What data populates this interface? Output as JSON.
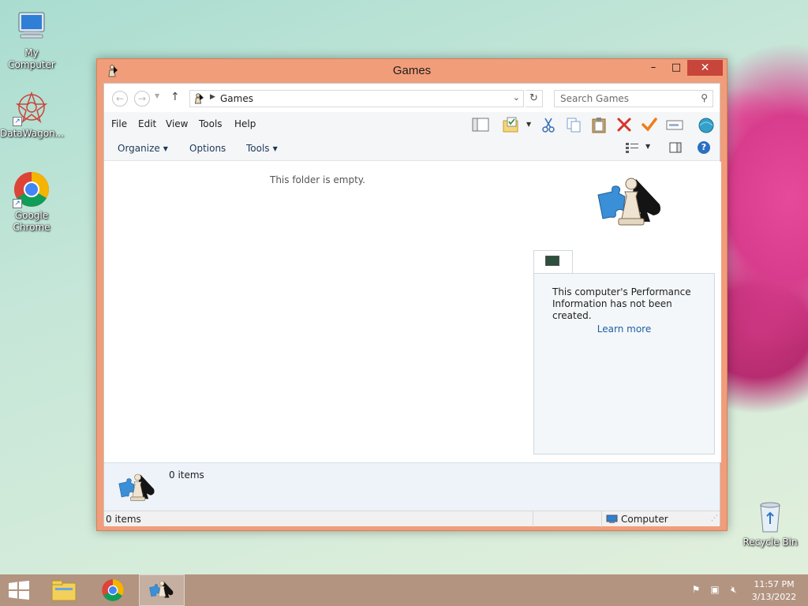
{
  "desktop": {
    "icons": [
      {
        "label": "My Computer"
      },
      {
        "label": "DataWagon..."
      },
      {
        "label": "Google Chrome"
      },
      {
        "label": "Recycle Bin"
      }
    ]
  },
  "window": {
    "title": "Games",
    "controls": {
      "minimize": "–",
      "maximize": "□",
      "close": "✕"
    }
  },
  "address": {
    "crumb": "Games",
    "search_placeholder": "Search Games"
  },
  "menu": {
    "items": [
      "File",
      "Edit",
      "View",
      "Tools",
      "Help"
    ]
  },
  "commandbar": {
    "organize": "Organize",
    "options": "Options",
    "tools": "Tools"
  },
  "content": {
    "empty_message": "This folder is empty."
  },
  "performance": {
    "message": "This computer's Performance Information has not been created.",
    "link": "Learn more"
  },
  "details": {
    "count": "0 items"
  },
  "status": {
    "items": "0 items",
    "location": "Computer"
  },
  "taskbar": {
    "time": "11:57 PM",
    "date": "3/13/2022"
  },
  "colors": {
    "window_frame": "#f29d79",
    "close_button": "#c7453a",
    "link": "#1d5fa3"
  }
}
